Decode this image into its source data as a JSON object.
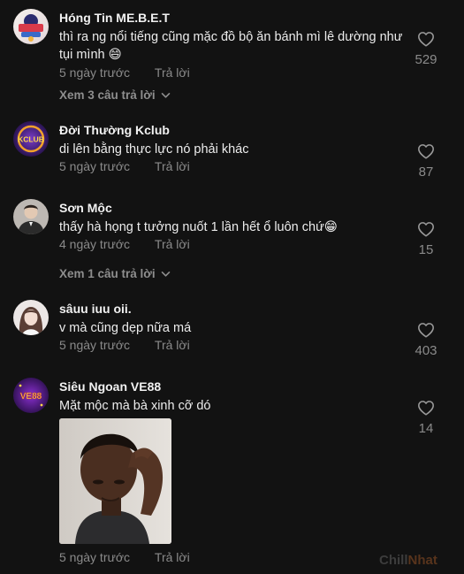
{
  "comments": [
    {
      "username": "Hóng Tin ME.B.E.T",
      "text": "thì ra ng nổi tiếng cũng mặc đồ bộ ăn bánh mì lê dường như tụi mình 😄",
      "time": "5 ngày trước",
      "reply_label": "Trả lời",
      "likes": "529",
      "view_replies": "Xem 3 câu trả lời"
    },
    {
      "username": "Đời Thường Kclub",
      "text": "di lên bằng thực lực nó phải khác",
      "time": "5 ngày trước",
      "reply_label": "Trả lời",
      "likes": "87",
      "avatar_text": "KCLUB"
    },
    {
      "username": "Sơn Mộc",
      "text": "thấy hà họng t tưởng nuốt 1 lần hết ổ luôn chứ😁",
      "time": "4 ngày trước",
      "reply_label": "Trả lời",
      "likes": "15",
      "view_replies": "Xem 1 câu trả lời"
    },
    {
      "username": "sâuu iuu oii.",
      "text": "v mà cũng dẹp nữa má",
      "time": "5 ngày trước",
      "reply_label": "Trả lời",
      "likes": "403"
    },
    {
      "username": "Siêu Ngoan VE88",
      "text": "Mặt mộc mà bà xinh cỡ dó",
      "time": "5 ngày trước",
      "reply_label": "Trả lời",
      "likes": "14",
      "avatar_text": "VE88"
    }
  ],
  "watermark": {
    "part1": "Chill",
    "part2": "Nhat"
  },
  "colors": {
    "background": "#121212",
    "muted_text": "#8a8a8a",
    "primary_text": "#ececec"
  },
  "icons": {
    "like": "heart-outline-icon",
    "expand": "chevron-down-icon"
  }
}
